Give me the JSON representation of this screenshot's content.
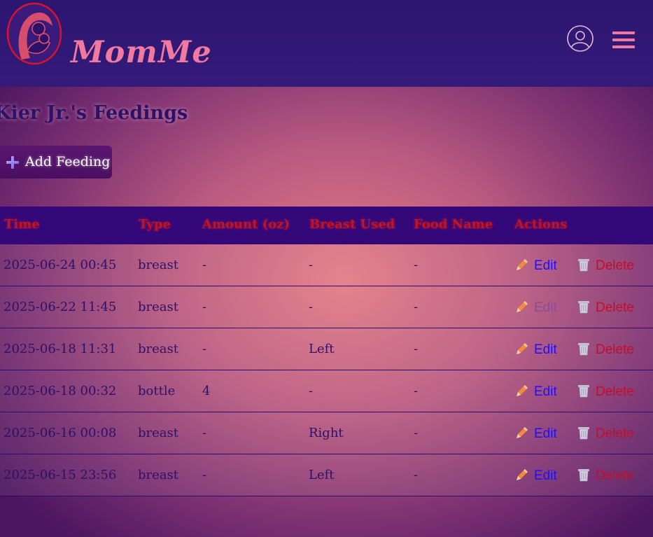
{
  "header": {
    "brand": "MomMe",
    "logo_icon": "mother-baby-logo-icon",
    "user_icon": "user-circle-icon",
    "menu_icon": "hamburger-menu-icon",
    "brand_color": "#f07a9f"
  },
  "page": {
    "title": "Kier Jr.'s Feedings",
    "add_button_label": "Add Feeding",
    "add_icon": "plus-icon"
  },
  "table": {
    "columns": [
      "Time",
      "Type",
      "Amount (oz)",
      "Breast Used",
      "Food Name",
      "Actions"
    ],
    "rows": [
      {
        "time": "2025-06-24 00:45",
        "type": "breast",
        "amount": "-",
        "breast": "-",
        "food": "-",
        "edit": "Edit",
        "delete": "Delete",
        "edit_state": "normal"
      },
      {
        "time": "2025-06-22 11:45",
        "type": "breast",
        "amount": "-",
        "breast": "-",
        "food": "-",
        "edit": "Edit",
        "delete": "Delete",
        "edit_state": "hover"
      },
      {
        "time": "2025-06-18 11:31",
        "type": "breast",
        "amount": "-",
        "breast": "Left",
        "food": "-",
        "edit": "Edit",
        "delete": "Delete",
        "edit_state": "normal"
      },
      {
        "time": "2025-06-18 00:32",
        "type": "bottle",
        "amount": "4",
        "breast": "-",
        "food": "-",
        "edit": "Edit",
        "delete": "Delete",
        "edit_state": "normal"
      },
      {
        "time": "2025-06-16 00:08",
        "type": "breast",
        "amount": "-",
        "breast": "Right",
        "food": "-",
        "edit": "Edit",
        "delete": "Delete",
        "edit_state": "normal"
      },
      {
        "time": "2025-06-15 23:56",
        "type": "breast",
        "amount": "-",
        "breast": "Left",
        "food": "-",
        "edit": "Edit",
        "delete": "Delete",
        "edit_state": "normal"
      }
    ],
    "edit_icon": "pencil-icon",
    "delete_icon": "trash-icon",
    "header_color": "#c4121f",
    "edit_color": "#1b10ff",
    "delete_color": "#c30e2a"
  }
}
